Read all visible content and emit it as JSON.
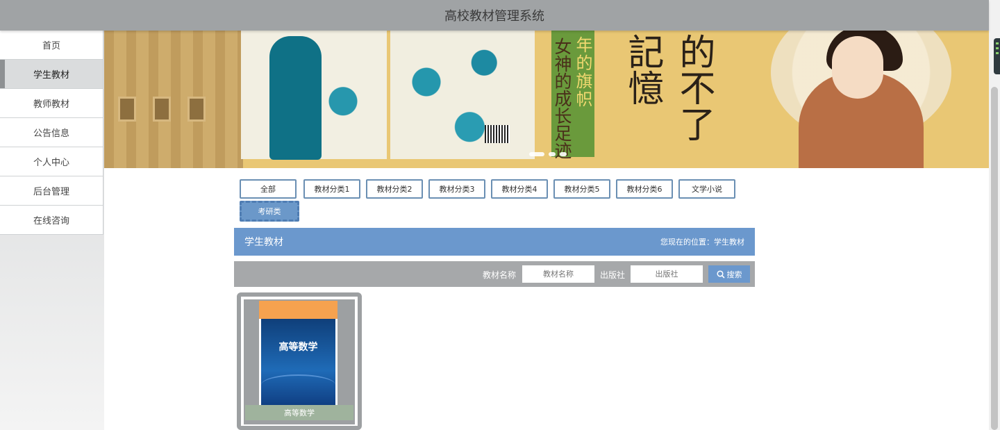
{
  "header": {
    "title": "高校教材管理系统"
  },
  "sidebar": {
    "items": [
      {
        "label": "首页"
      },
      {
        "label": "学生教材"
      },
      {
        "label": "教师教材"
      },
      {
        "label": "公告信息"
      },
      {
        "label": "个人中心"
      },
      {
        "label": "后台管理"
      },
      {
        "label": "在线咨询"
      }
    ],
    "active_index": 1
  },
  "banner": {
    "vertical_text_a": "年的旗帜",
    "vertical_text_b": "女神的成长足迹",
    "big_text": "的不了記憶"
  },
  "categories": {
    "items": [
      {
        "label": "全部"
      },
      {
        "label": "教材分类1"
      },
      {
        "label": "教材分类2"
      },
      {
        "label": "教材分类3"
      },
      {
        "label": "教材分类4"
      },
      {
        "label": "教材分类5"
      },
      {
        "label": "教材分类6"
      },
      {
        "label": "文学小说"
      },
      {
        "label": "考研类"
      }
    ],
    "active_index": 8
  },
  "section": {
    "title": "学生教材",
    "location": "您现在的位置：学生教材"
  },
  "search": {
    "name_label": "教材名称",
    "name_placeholder": "教材名称",
    "publisher_label": "出版社",
    "publisher_placeholder": "出版社",
    "button_label": "搜索"
  },
  "products": [
    {
      "name": "高等数学",
      "cover_title": "高等数学"
    }
  ],
  "colors": {
    "accent": "#6b98cd",
    "header_bg": "#a0a3a5",
    "card_caption": "#9fb39d"
  }
}
